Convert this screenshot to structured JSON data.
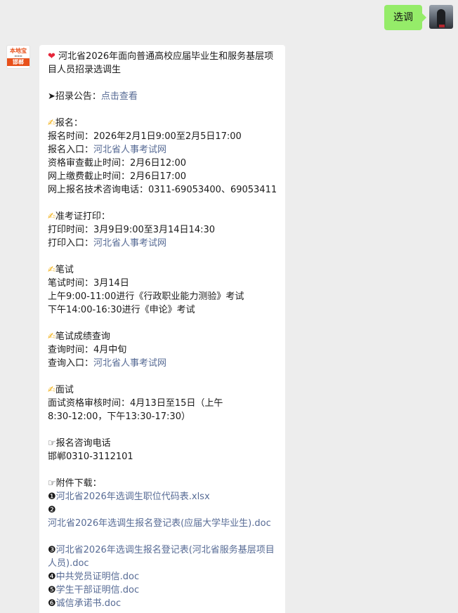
{
  "outgoing": {
    "text": "选调"
  },
  "bot": {
    "logo_text": "本地宝",
    "city": "邯郸"
  },
  "message": {
    "title_icon": "❤",
    "title": "河北省2026年面向普通高校应届毕业生和服务基层项目人员招录选调生",
    "announcement": {
      "arrow": "➤",
      "label": "招录公告：",
      "link": "点击查看"
    },
    "registration": {
      "icon": "✍",
      "heading": "报名：",
      "time": "报名时间：2026年2月1日9:00至2月5日17:00",
      "entry_label": "报名入口：",
      "entry_link": "河北省人事考试网",
      "review_deadline": "资格审查截止时间：2月6日12:00",
      "payment_deadline": "网上缴费截止时间：2月6日17:00",
      "tech_phone": "网上报名技术咨询电话：0311-69053400、69053411"
    },
    "admission": {
      "icon": "✍",
      "heading": "准考证打印：",
      "time": "打印时间：3月9日9:00至3月14日14:30",
      "entry_label": "打印入口：",
      "entry_link": "河北省人事考试网"
    },
    "written": {
      "icon": "✍",
      "heading": "笔试",
      "time": "笔试时间：3月14日",
      "morning": "上午9:00-11:00进行《行政职业能力测验》考试",
      "afternoon": "下午14:00-16:30进行《申论》考试"
    },
    "score": {
      "icon": "✍",
      "heading": "笔试成绩查询",
      "time": "查询时间：4月中旬",
      "entry_label": "查询入口：",
      "entry_link": "河北省人事考试网"
    },
    "interview": {
      "icon": "✍",
      "heading": "面试",
      "line1": "面试资格审核时间：4月13日至15日（上午",
      "line2": "8:30-12:00，下午13:30-17:30）"
    },
    "consult": {
      "icon": "☞",
      "heading": "报名咨询电话",
      "phone": "邯郸0310-3112101"
    },
    "attachments": {
      "icon": "☞",
      "heading": "附件下载：",
      "items": [
        {
          "num": "❶",
          "name": "河北省2026年选调生职位代码表.xlsx"
        },
        {
          "num": "❷",
          "name": "河北省2026年选调生报名登记表(应届大学毕业生).doc"
        },
        {
          "num": "❸",
          "name": "河北省2026年选调生报名登记表(河北省服务基层项目人员).doc"
        },
        {
          "num": "❹",
          "name": "中共党员证明信.doc"
        },
        {
          "num": "❺",
          "name": "学生干部证明信.doc"
        },
        {
          "num": "❻",
          "name": "诚信承诺书.doc"
        }
      ]
    }
  }
}
